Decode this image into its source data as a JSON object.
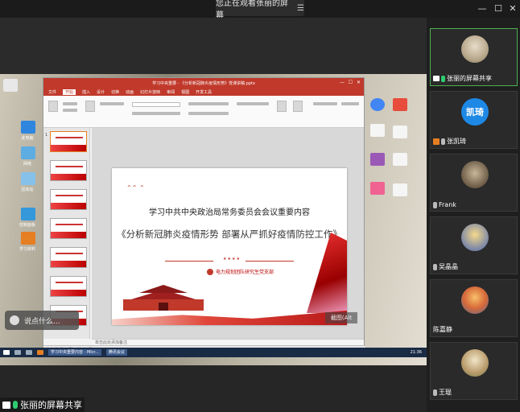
{
  "banner": {
    "text": "您正在观看张丽的屏幕",
    "menu_icon": "menu-icon"
  },
  "window_controls": {
    "minimize": "—",
    "maximize": "☐",
    "close": "✕"
  },
  "ppt": {
    "title": "学习中央重要 - 《分析新冠肺炎疫情形势》党课讲稿.pptx",
    "menu": [
      "文件",
      "开始",
      "插入",
      "设计",
      "切换",
      "动画",
      "幻灯片放映",
      "审阅",
      "视图",
      "开发工具"
    ],
    "active_menu": "开始",
    "thumb_count": 7,
    "notes_placeholder": "单击此处添加备注",
    "status": "幻灯片 第 1 张，共 36 张",
    "slide": {
      "subtitle": "学习中共中央政治局常务委员会会议重要内容",
      "main_title": "《分析新冠肺炎疫情形势  部署从严抓好疫情防控工作》",
      "org": "电力规划团队研究生党支部",
      "stars": "★★★★"
    }
  },
  "taskbar": {
    "task1": "学习中央重要内容 - Micr...",
    "task2": "腾讯会议",
    "clock": "21:36"
  },
  "comment": {
    "placeholder": "说点什么..."
  },
  "fullscreen": {
    "label": "截图(Alt"
  },
  "sharer_label": "张丽的屏幕共享",
  "participants": [
    {
      "name": "张丽的屏幕共享",
      "mic": "on"
    },
    {
      "name": "张凯琦",
      "avatar_text": "凯琦",
      "mic": "off"
    },
    {
      "name": "Frank",
      "mic": "off"
    },
    {
      "name": "吴晶晶",
      "mic": "off"
    },
    {
      "name": "陈嘉静",
      "mic": "none"
    },
    {
      "name": "王琨",
      "mic": "off"
    }
  ],
  "desktop_icons": [
    "此电脑",
    "网络",
    "回收站",
    "控制面板",
    "学习资料"
  ]
}
